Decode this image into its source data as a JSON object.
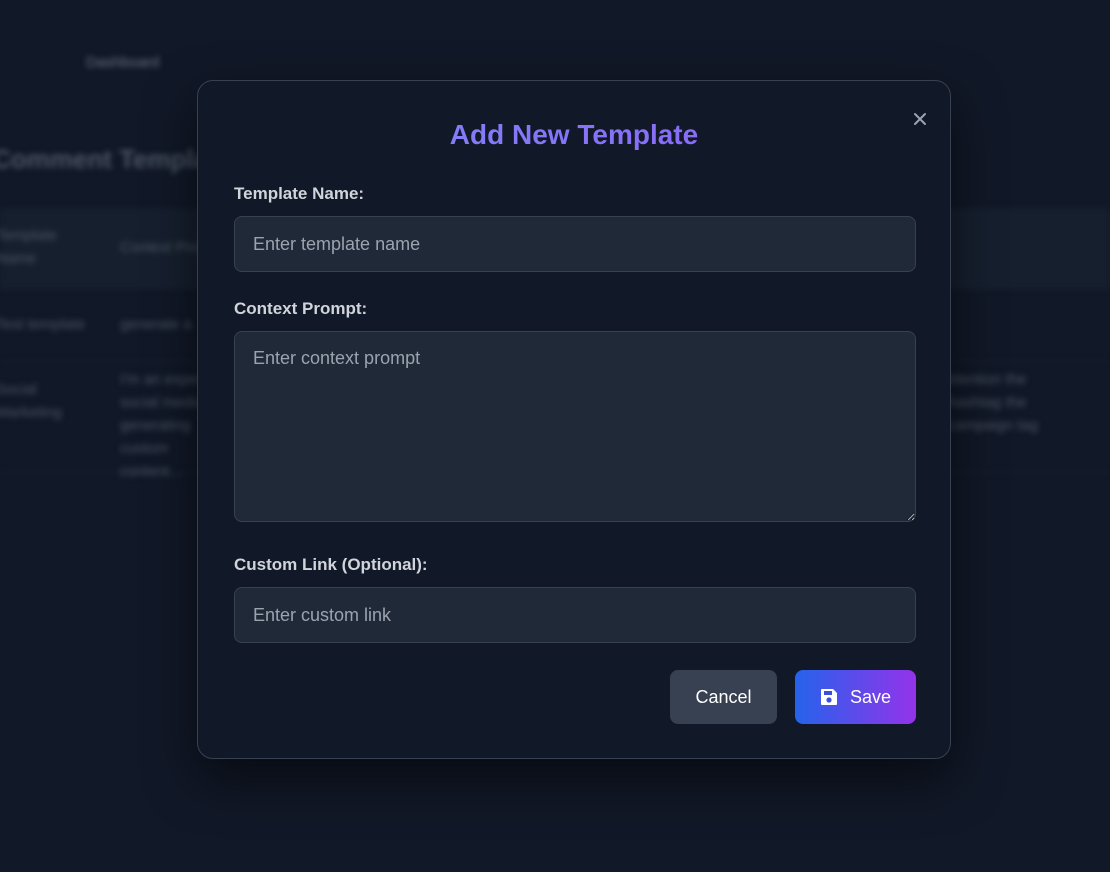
{
  "background": {
    "breadcrumb": "Dashboard",
    "page_title": "Comment Templates",
    "table": {
      "header_col1": "Template Name",
      "header_col2": "Context Prompt",
      "row1_col1": "Test template",
      "row1_col2": "generate a",
      "row2_col1": "Social Marketing",
      "row2_col2": "I'm an expert social media, generating custom content...",
      "row2_col3": "Mention the hashtag the campaign tag"
    }
  },
  "modal": {
    "title": "Add New Template",
    "close_icon": "close-icon",
    "fields": {
      "name": {
        "label": "Template Name:",
        "placeholder": "Enter template name",
        "value": ""
      },
      "context": {
        "label": "Context Prompt:",
        "placeholder": "Enter context prompt",
        "value": ""
      },
      "link": {
        "label": "Custom Link (Optional):",
        "placeholder": "Enter custom link",
        "value": ""
      }
    },
    "actions": {
      "cancel_label": "Cancel",
      "save_label": "Save",
      "save_icon": "floppy-disk-icon"
    }
  },
  "colors": {
    "background": "#111827",
    "modal_border": "#374151",
    "input_bg": "#1f2937",
    "title_gradient_start": "#818cf8",
    "title_gradient_end": "#8b5cf6",
    "save_gradient_start": "#2563eb",
    "save_gradient_end": "#9333ea",
    "cancel_bg": "#374151"
  }
}
